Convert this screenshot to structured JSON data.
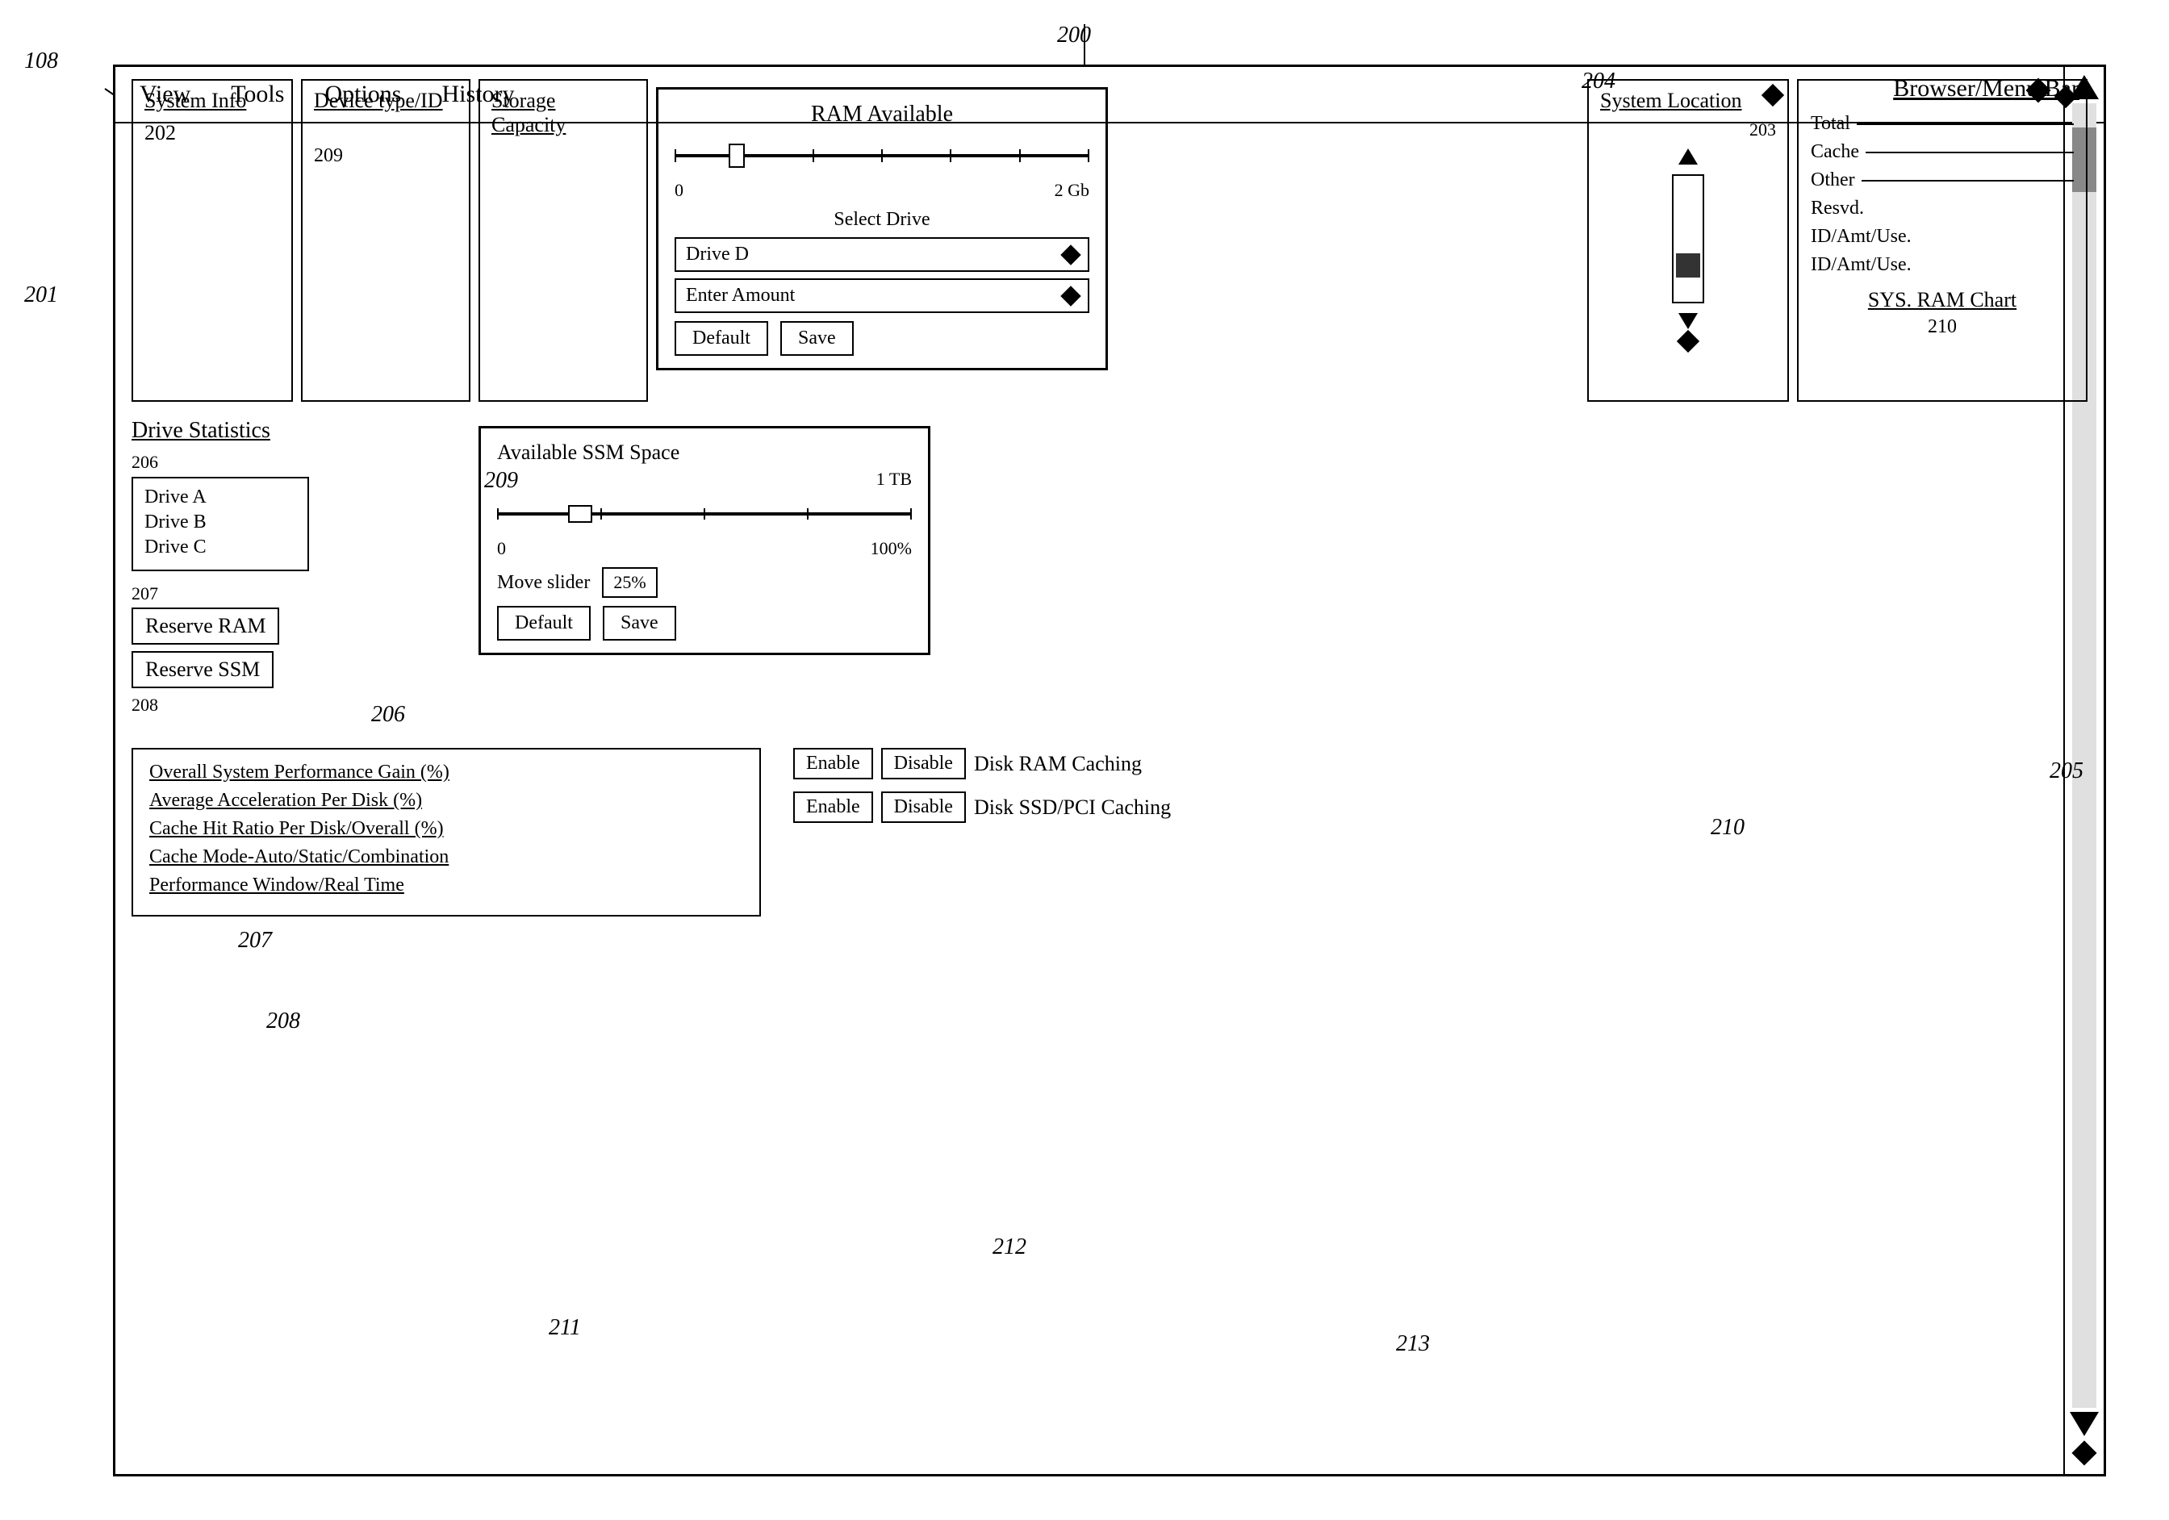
{
  "refs": {
    "r108": "108",
    "r200": "200",
    "r201": "201",
    "r202": "202",
    "r203": "203",
    "r204": "204",
    "r205": "205",
    "r206": "206",
    "r207": "207",
    "r208": "208",
    "r209": "209",
    "r210": "210",
    "r211": "211",
    "r212": "212",
    "r213": "213"
  },
  "browser": {
    "menu_bar_label": "Browser/Menu Bar",
    "menu_items": [
      "View",
      "Tools",
      "Options",
      "History"
    ]
  },
  "system_info": {
    "title": "System Info",
    "ref": "202"
  },
  "device_type": {
    "title": "Device type/ID",
    "ref": "209"
  },
  "storage_capacity": {
    "title": "Storage Capacity"
  },
  "system_location": {
    "title": "System Location",
    "ref": "203"
  },
  "right_chart": {
    "title": "SYS. RAM Chart",
    "ref": "210",
    "entries": [
      {
        "label": "Total",
        "line": true
      },
      {
        "label": "Cache",
        "line": true
      },
      {
        "label": "Other",
        "line": true
      },
      {
        "label": "Resvd.",
        "line": false
      },
      {
        "label": "ID/Amt/Use.",
        "line": false
      },
      {
        "label": "ID/Amt/Use.",
        "line": false
      }
    ]
  },
  "ram_available": {
    "title": "RAM Available",
    "slider_min": "0",
    "slider_max": "2 Gb",
    "select_drive_label": "Select Drive",
    "drive_selected": "Drive D",
    "enter_amount_label": "Enter Amount",
    "default_btn": "Default",
    "save_btn": "Save"
  },
  "drive_statistics": {
    "title": "Drive Statistics",
    "drives": [
      "Drive A",
      "Drive B",
      "Drive C"
    ],
    "ref": "206"
  },
  "ssm_space": {
    "title": "Available SSM Space",
    "tb_label": "1 TB",
    "slider_min": "0",
    "slider_max": "100%",
    "move_slider_label": "Move slider",
    "percent_value": "25%",
    "default_btn": "Default",
    "save_btn": "Save"
  },
  "reserve_buttons": {
    "reserve_ram": "Reserve RAM",
    "reserve_ssm": "Reserve SSM",
    "ref_207": "207",
    "ref_208": "208"
  },
  "performance_panel": {
    "ref": "211",
    "items": [
      "Overall System Performance Gain (%)",
      "Average Acceleration Per Disk (%)",
      "Cache Hit Ratio Per Disk/Overall (%)",
      "Cache Mode-Auto/Static/Combination",
      "Performance Window/Real Time"
    ]
  },
  "caching": {
    "ref_212": "212",
    "ref_213": "213",
    "rows": [
      {
        "enable_label": "Enable",
        "disable_label": "Disable",
        "description": "Disk RAM Caching"
      },
      {
        "enable_label": "Enable",
        "disable_label": "Disable",
        "description": "Disk SSD/PCI Caching"
      }
    ]
  }
}
